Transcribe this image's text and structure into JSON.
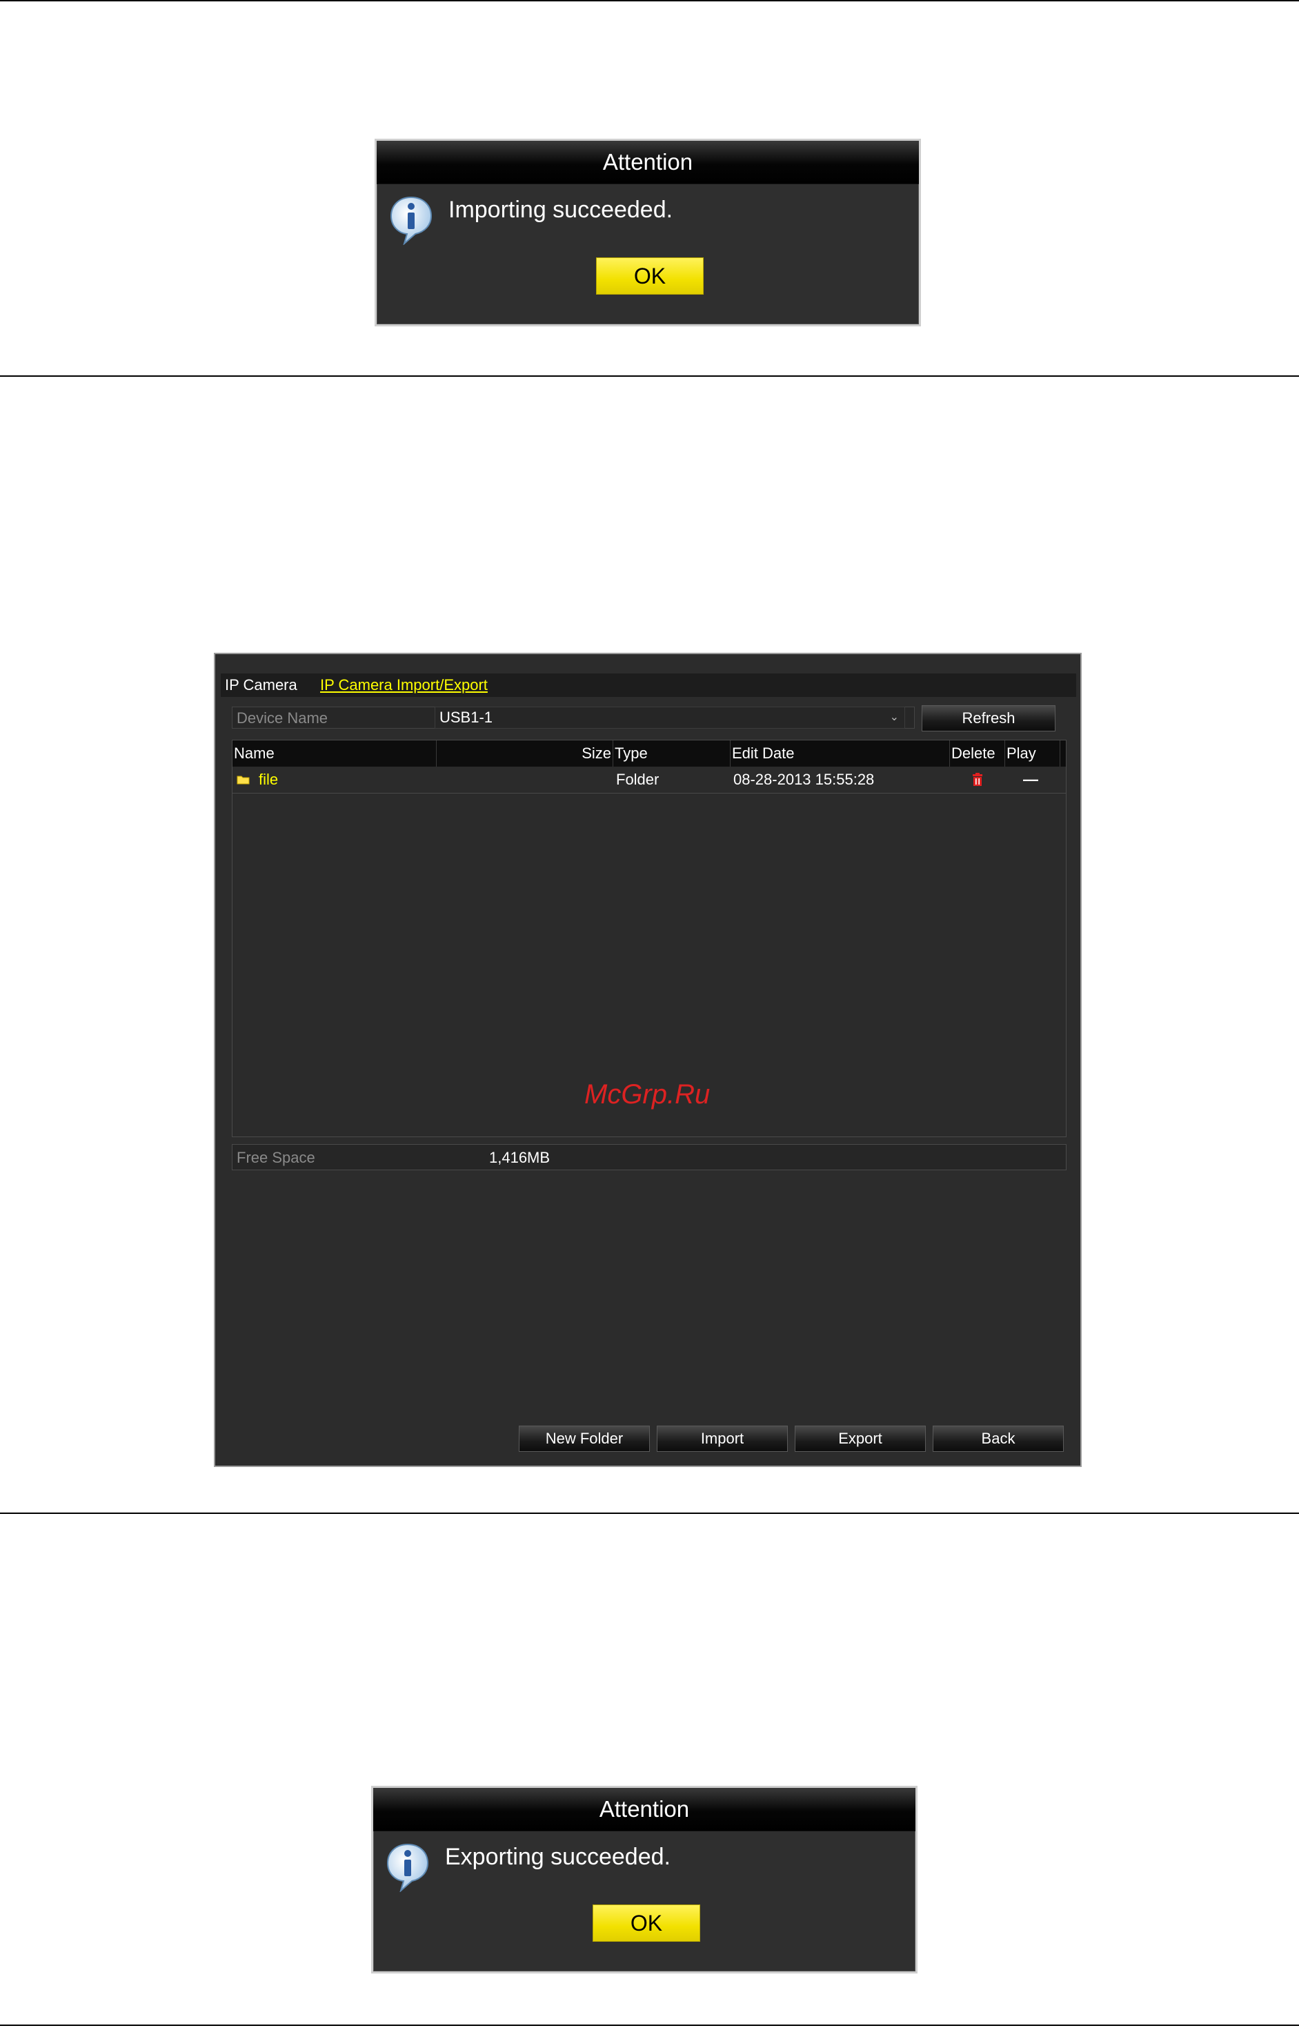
{
  "dialog_import": {
    "title": "Attention",
    "message": "Importing succeeded.",
    "ok_label": "OK"
  },
  "main_window": {
    "tabs": [
      {
        "label": "IP Camera",
        "active": false
      },
      {
        "label": "IP Camera Import/Export",
        "active": true
      }
    ],
    "device_name_label": "Device Name",
    "device_name_value": "USB1-1",
    "refresh_label": "Refresh",
    "table": {
      "columns": [
        "Name",
        "Size",
        "Type",
        "Edit Date",
        "Delete",
        "Play"
      ],
      "rows": [
        {
          "name": "file",
          "size": "",
          "type": "Folder",
          "edit_date": "08-28-2013 15:55:28",
          "delete_icon": "trash-icon",
          "play": "—"
        }
      ]
    },
    "watermark": "McGrp.Ru",
    "free_space_label": "Free Space",
    "free_space_value": "1,416MB",
    "buttons": {
      "new_folder": "New Folder",
      "import": "Import",
      "export": "Export",
      "back": "Back"
    }
  },
  "dialog_export": {
    "title": "Attention",
    "message": "Exporting succeeded.",
    "ok_label": "OK"
  },
  "colors": {
    "accent_yellow": "#ffff00",
    "ok_button": "#f2e100",
    "panel_bg": "#2c2c2c",
    "delete_red": "#e02020",
    "watermark_red": "#dd2222"
  }
}
